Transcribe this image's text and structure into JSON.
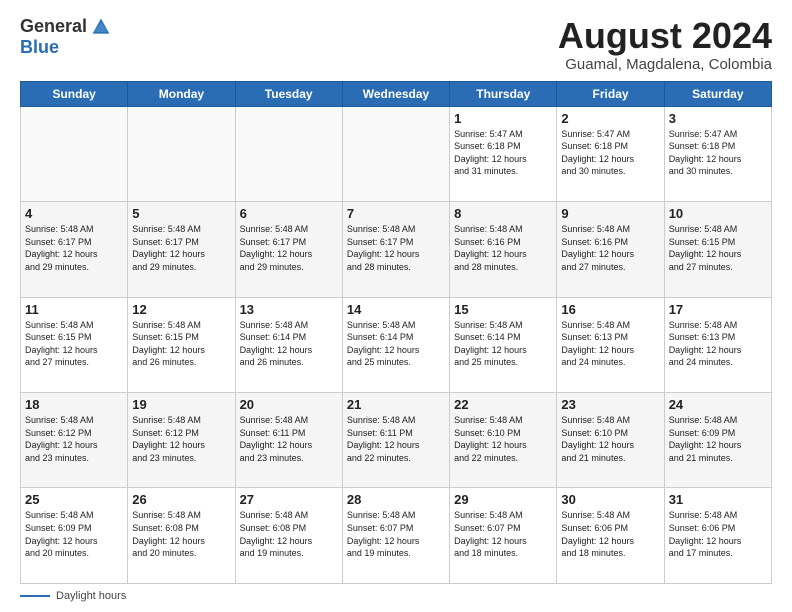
{
  "logo": {
    "general": "General",
    "blue": "Blue"
  },
  "title": "August 2024",
  "subtitle": "Guamal, Magdalena, Colombia",
  "days_of_week": [
    "Sunday",
    "Monday",
    "Tuesday",
    "Wednesday",
    "Thursday",
    "Friday",
    "Saturday"
  ],
  "weeks": [
    [
      {
        "day": "",
        "info": ""
      },
      {
        "day": "",
        "info": ""
      },
      {
        "day": "",
        "info": ""
      },
      {
        "day": "",
        "info": ""
      },
      {
        "day": "1",
        "info": "Sunrise: 5:47 AM\nSunset: 6:18 PM\nDaylight: 12 hours\nand 31 minutes."
      },
      {
        "day": "2",
        "info": "Sunrise: 5:47 AM\nSunset: 6:18 PM\nDaylight: 12 hours\nand 30 minutes."
      },
      {
        "day": "3",
        "info": "Sunrise: 5:47 AM\nSunset: 6:18 PM\nDaylight: 12 hours\nand 30 minutes."
      }
    ],
    [
      {
        "day": "4",
        "info": "Sunrise: 5:48 AM\nSunset: 6:17 PM\nDaylight: 12 hours\nand 29 minutes."
      },
      {
        "day": "5",
        "info": "Sunrise: 5:48 AM\nSunset: 6:17 PM\nDaylight: 12 hours\nand 29 minutes."
      },
      {
        "day": "6",
        "info": "Sunrise: 5:48 AM\nSunset: 6:17 PM\nDaylight: 12 hours\nand 29 minutes."
      },
      {
        "day": "7",
        "info": "Sunrise: 5:48 AM\nSunset: 6:17 PM\nDaylight: 12 hours\nand 28 minutes."
      },
      {
        "day": "8",
        "info": "Sunrise: 5:48 AM\nSunset: 6:16 PM\nDaylight: 12 hours\nand 28 minutes."
      },
      {
        "day": "9",
        "info": "Sunrise: 5:48 AM\nSunset: 6:16 PM\nDaylight: 12 hours\nand 27 minutes."
      },
      {
        "day": "10",
        "info": "Sunrise: 5:48 AM\nSunset: 6:15 PM\nDaylight: 12 hours\nand 27 minutes."
      }
    ],
    [
      {
        "day": "11",
        "info": "Sunrise: 5:48 AM\nSunset: 6:15 PM\nDaylight: 12 hours\nand 27 minutes."
      },
      {
        "day": "12",
        "info": "Sunrise: 5:48 AM\nSunset: 6:15 PM\nDaylight: 12 hours\nand 26 minutes."
      },
      {
        "day": "13",
        "info": "Sunrise: 5:48 AM\nSunset: 6:14 PM\nDaylight: 12 hours\nand 26 minutes."
      },
      {
        "day": "14",
        "info": "Sunrise: 5:48 AM\nSunset: 6:14 PM\nDaylight: 12 hours\nand 25 minutes."
      },
      {
        "day": "15",
        "info": "Sunrise: 5:48 AM\nSunset: 6:14 PM\nDaylight: 12 hours\nand 25 minutes."
      },
      {
        "day": "16",
        "info": "Sunrise: 5:48 AM\nSunset: 6:13 PM\nDaylight: 12 hours\nand 24 minutes."
      },
      {
        "day": "17",
        "info": "Sunrise: 5:48 AM\nSunset: 6:13 PM\nDaylight: 12 hours\nand 24 minutes."
      }
    ],
    [
      {
        "day": "18",
        "info": "Sunrise: 5:48 AM\nSunset: 6:12 PM\nDaylight: 12 hours\nand 23 minutes."
      },
      {
        "day": "19",
        "info": "Sunrise: 5:48 AM\nSunset: 6:12 PM\nDaylight: 12 hours\nand 23 minutes."
      },
      {
        "day": "20",
        "info": "Sunrise: 5:48 AM\nSunset: 6:11 PM\nDaylight: 12 hours\nand 23 minutes."
      },
      {
        "day": "21",
        "info": "Sunrise: 5:48 AM\nSunset: 6:11 PM\nDaylight: 12 hours\nand 22 minutes."
      },
      {
        "day": "22",
        "info": "Sunrise: 5:48 AM\nSunset: 6:10 PM\nDaylight: 12 hours\nand 22 minutes."
      },
      {
        "day": "23",
        "info": "Sunrise: 5:48 AM\nSunset: 6:10 PM\nDaylight: 12 hours\nand 21 minutes."
      },
      {
        "day": "24",
        "info": "Sunrise: 5:48 AM\nSunset: 6:09 PM\nDaylight: 12 hours\nand 21 minutes."
      }
    ],
    [
      {
        "day": "25",
        "info": "Sunrise: 5:48 AM\nSunset: 6:09 PM\nDaylight: 12 hours\nand 20 minutes."
      },
      {
        "day": "26",
        "info": "Sunrise: 5:48 AM\nSunset: 6:08 PM\nDaylight: 12 hours\nand 20 minutes."
      },
      {
        "day": "27",
        "info": "Sunrise: 5:48 AM\nSunset: 6:08 PM\nDaylight: 12 hours\nand 19 minutes."
      },
      {
        "day": "28",
        "info": "Sunrise: 5:48 AM\nSunset: 6:07 PM\nDaylight: 12 hours\nand 19 minutes."
      },
      {
        "day": "29",
        "info": "Sunrise: 5:48 AM\nSunset: 6:07 PM\nDaylight: 12 hours\nand 18 minutes."
      },
      {
        "day": "30",
        "info": "Sunrise: 5:48 AM\nSunset: 6:06 PM\nDaylight: 12 hours\nand 18 minutes."
      },
      {
        "day": "31",
        "info": "Sunrise: 5:48 AM\nSunset: 6:06 PM\nDaylight: 12 hours\nand 17 minutes."
      }
    ]
  ],
  "footer": {
    "label": "Daylight hours"
  }
}
